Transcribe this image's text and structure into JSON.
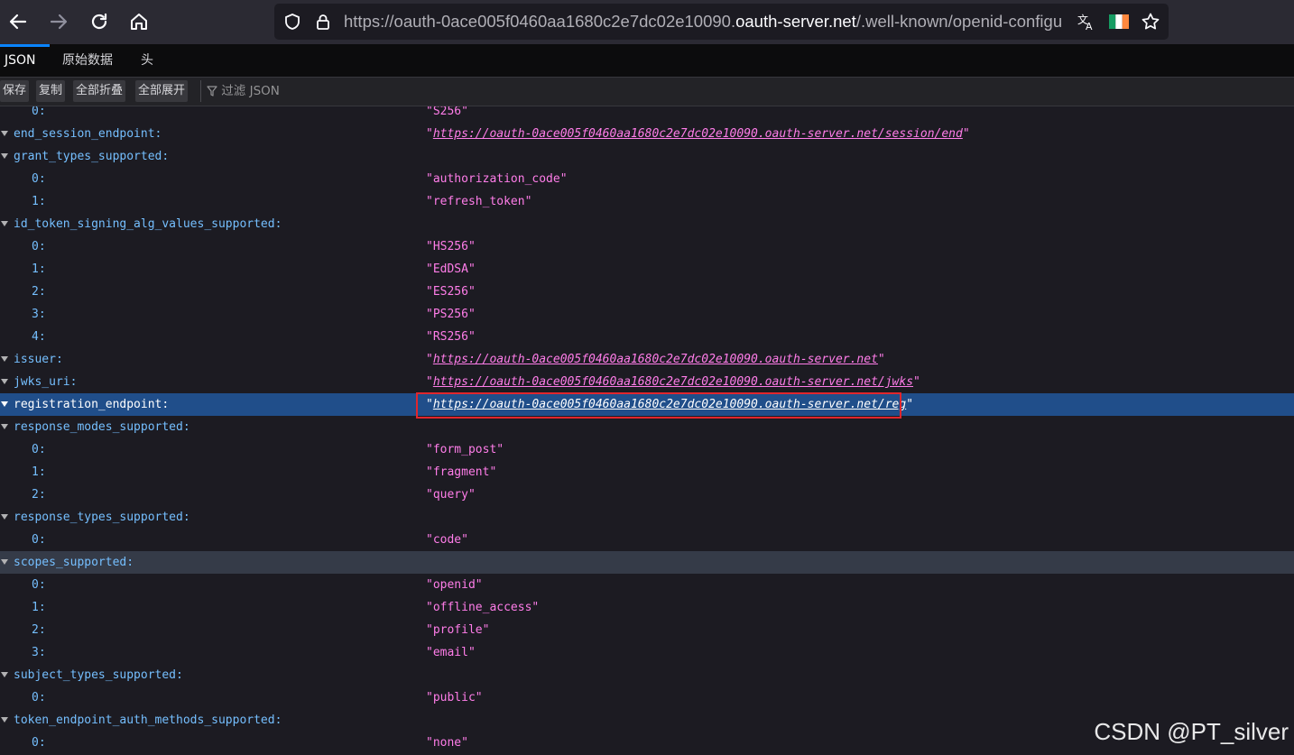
{
  "browser": {
    "url_prefix": "https://oauth-0ace005f0460aa1680c2e7dc02e10090.",
    "url_host": "oauth-server.net",
    "url_suffix": "/.well-known/openid-configu"
  },
  "viewer": {
    "tabs": [
      "JSON",
      "原始数据",
      "头"
    ],
    "buttons": [
      "保存",
      "复制",
      "全部折叠",
      "全部展开"
    ],
    "filter_placeholder": "过滤 JSON"
  },
  "rows": [
    {
      "key": "0:",
      "value": "\"S256\"",
      "indent": 1
    },
    {
      "key": "end_session_endpoint:",
      "value": "https://oauth-0ace005f0460aa1680c2e7dc02e10090.oauth-server.net/session/end",
      "link": true,
      "indent": 0
    },
    {
      "key": "grant_types_supported:",
      "indent": 0,
      "expandable": true
    },
    {
      "key": "0:",
      "value": "\"authorization_code\"",
      "indent": 1
    },
    {
      "key": "1:",
      "value": "\"refresh_token\"",
      "indent": 1
    },
    {
      "key": "id_token_signing_alg_values_supported:",
      "indent": 0,
      "expandable": true
    },
    {
      "key": "0:",
      "value": "\"HS256\"",
      "indent": 1
    },
    {
      "key": "1:",
      "value": "\"EdDSA\"",
      "indent": 1
    },
    {
      "key": "2:",
      "value": "\"ES256\"",
      "indent": 1
    },
    {
      "key": "3:",
      "value": "\"PS256\"",
      "indent": 1
    },
    {
      "key": "4:",
      "value": "\"RS256\"",
      "indent": 1
    },
    {
      "key": "issuer:",
      "value": "https://oauth-0ace005f0460aa1680c2e7dc02e10090.oauth-server.net",
      "link": true,
      "indent": 0
    },
    {
      "key": "jwks_uri:",
      "value": "https://oauth-0ace005f0460aa1680c2e7dc02e10090.oauth-server.net/jwks",
      "link": true,
      "indent": 0
    },
    {
      "key": "registration_endpoint:",
      "value": "https://oauth-0ace005f0460aa1680c2e7dc02e10090.oauth-server.net/reg",
      "link": true,
      "indent": 0,
      "selected": true
    },
    {
      "key": "response_modes_supported:",
      "indent": 0,
      "expandable": true
    },
    {
      "key": "0:",
      "value": "\"form_post\"",
      "indent": 1
    },
    {
      "key": "1:",
      "value": "\"fragment\"",
      "indent": 1
    },
    {
      "key": "2:",
      "value": "\"query\"",
      "indent": 1
    },
    {
      "key": "response_types_supported:",
      "indent": 0,
      "expandable": true
    },
    {
      "key": "0:",
      "value": "\"code\"",
      "indent": 1
    },
    {
      "key": "scopes_supported:",
      "indent": 0,
      "expandable": true,
      "hover": true
    },
    {
      "key": "0:",
      "value": "\"openid\"",
      "indent": 1
    },
    {
      "key": "1:",
      "value": "\"offline_access\"",
      "indent": 1
    },
    {
      "key": "2:",
      "value": "\"profile\"",
      "indent": 1
    },
    {
      "key": "3:",
      "value": "\"email\"",
      "indent": 1
    },
    {
      "key": "subject_types_supported:",
      "indent": 0,
      "expandable": true
    },
    {
      "key": "0:",
      "value": "\"public\"",
      "indent": 1
    },
    {
      "key": "token_endpoint_auth_methods_supported:",
      "indent": 0,
      "expandable": true
    },
    {
      "key": "0:",
      "value": "\"none\"",
      "indent": 1
    }
  ],
  "watermark": "CSDN @PT_silver",
  "colors": {
    "key": "#75bfff",
    "string": "#ff7de9",
    "selected_bg": "#204e8a",
    "highlight_border": "#e0262d"
  }
}
